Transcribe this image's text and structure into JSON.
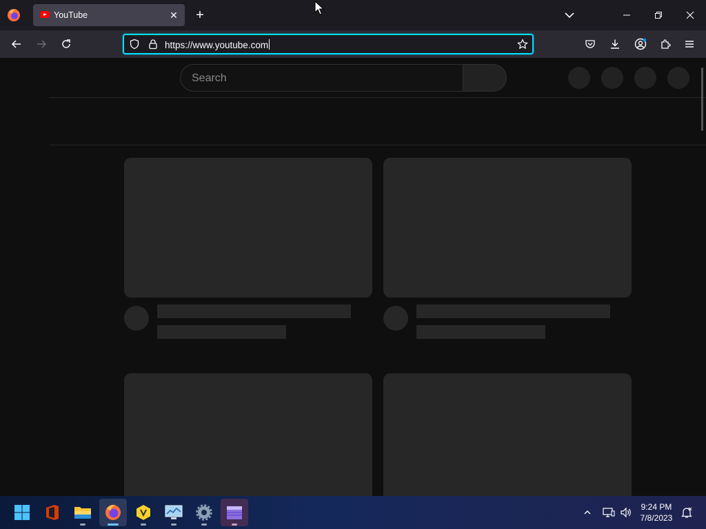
{
  "browser": {
    "tab": {
      "title": "YouTube",
      "close_glyph": "✕"
    },
    "new_tab_glyph": "+",
    "address": {
      "url": "https://www.youtube.com"
    },
    "window_controls": [
      "minimize",
      "restore",
      "close"
    ]
  },
  "page": {
    "search": {
      "placeholder": "Search"
    }
  },
  "taskbar": {
    "apps": [
      "start",
      "office",
      "file-explorer",
      "firefox",
      "vscodium-like",
      "activity-monitor",
      "settings",
      "clapper"
    ],
    "clock": {
      "time": "9:24 PM",
      "date": "7/8/2023"
    }
  },
  "colors": {
    "tab_active": "#42414d",
    "url_focus": "#00ddff",
    "page_bg": "#0f0f0f",
    "skeleton": "#272727"
  }
}
